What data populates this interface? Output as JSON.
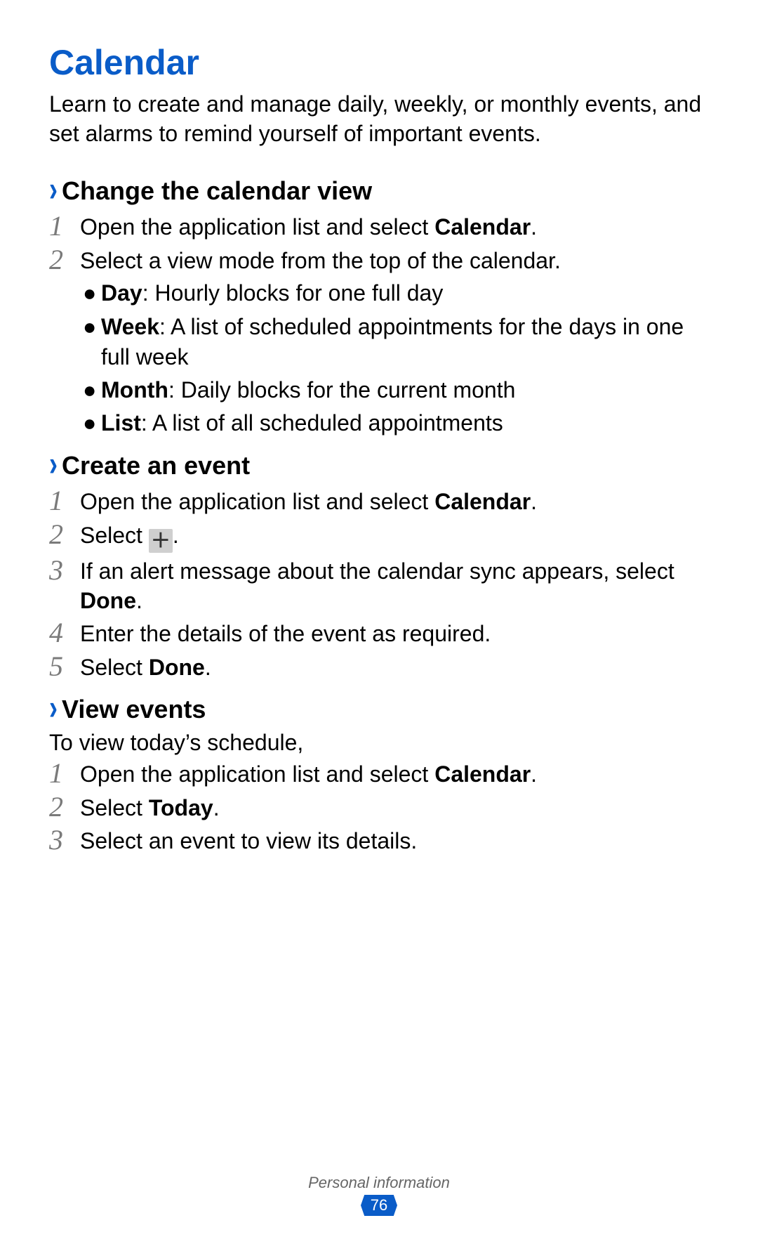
{
  "title": "Calendar",
  "intro": "Learn to create and manage daily, weekly, or monthly events, and set alarms to remind yourself of important events.",
  "sections": {
    "change_view": {
      "heading": "Change the calendar view",
      "step1_a": "Open the application list and select ",
      "step1_b": "Calendar",
      "step1_c": ".",
      "step2": "Select a view mode from the top of the calendar.",
      "bullets": {
        "day_label": "Day",
        "day_desc": ": Hourly blocks for one full day",
        "week_label": "Week",
        "week_desc": ": A list of scheduled appointments for the days in one full week",
        "month_label": "Month",
        "month_desc": ": Daily blocks for the current month",
        "list_label": "List",
        "list_desc": ": A list of all scheduled appointments"
      }
    },
    "create_event": {
      "heading": "Create an event",
      "step1_a": "Open the application list and select ",
      "step1_b": "Calendar",
      "step1_c": ".",
      "step2_a": "Select ",
      "step2_b": ".",
      "step3_a": "If an alert message about the calendar sync appears, select ",
      "step3_b": "Done",
      "step3_c": ".",
      "step4": "Enter the details of the event as required.",
      "step5_a": "Select ",
      "step5_b": "Done",
      "step5_c": "."
    },
    "view_events": {
      "heading": "View events",
      "lead": "To view today’s schedule,",
      "step1_a": "Open the application list and select ",
      "step1_b": "Calendar",
      "step1_c": ".",
      "step2_a": "Select ",
      "step2_b": "Today",
      "step2_c": ".",
      "step3": "Select an event to view its details."
    }
  },
  "numbers": {
    "n1": "1",
    "n2": "2",
    "n3": "3",
    "n4": "4",
    "n5": "5"
  },
  "chevron": "›",
  "bullet": "●",
  "plus": "＋",
  "footer": {
    "label": "Personal information",
    "page": "76"
  }
}
